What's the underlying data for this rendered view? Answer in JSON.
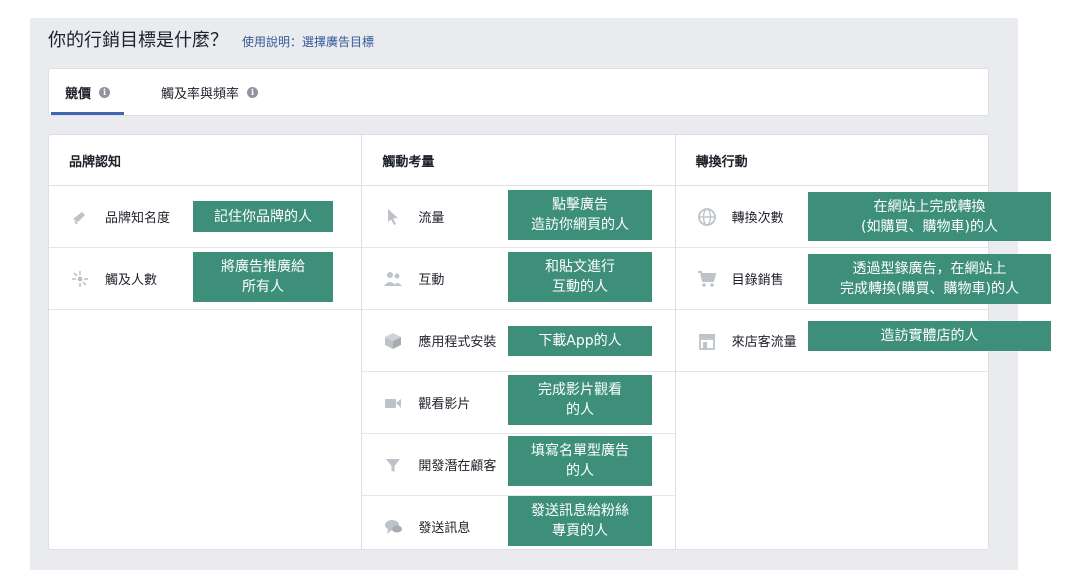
{
  "header": {
    "title": "你的行銷目標是什麼？",
    "help_link": "使用說明：選擇廣告目標"
  },
  "tabs": [
    {
      "label": "競價"
    },
    {
      "label": "觸及率與頻率"
    }
  ],
  "columns": [
    {
      "title": "品牌認知",
      "items": [
        {
          "label": "品牌知名度",
          "icon": "megaphone-icon",
          "note": "記住你品牌的人"
        },
        {
          "label": "觸及人數",
          "icon": "reach-icon",
          "note": "將廣告推廣給\n所有人"
        }
      ]
    },
    {
      "title": "觸動考量",
      "items": [
        {
          "label": "流量",
          "icon": "cursor-icon",
          "note": "點擊廣告\n造訪你網頁的人"
        },
        {
          "label": "互動",
          "icon": "people-icon",
          "note": "和貼文進行\n互動的人"
        },
        {
          "label": "應用程式安裝",
          "icon": "box-icon",
          "note": "下載App的人"
        },
        {
          "label": "觀看影片",
          "icon": "video-icon",
          "note": "完成影片觀看\n的人"
        },
        {
          "label": "開發潛在顧客",
          "icon": "funnel-icon",
          "note": "填寫名單型廣告\n的人"
        },
        {
          "label": "發送訊息",
          "icon": "chat-icon",
          "note": "發送訊息給粉絲\n專頁的人"
        }
      ]
    },
    {
      "title": "轉換行動",
      "items": [
        {
          "label": "轉換次數",
          "icon": "globe-icon",
          "note": "在網站上完成轉換\n(如購買、購物車)的人"
        },
        {
          "label": "目錄銷售",
          "icon": "cart-icon",
          "note": "透過型錄廣告，在網站上\n完成轉換(購買、購物車)的人"
        },
        {
          "label": "來店客流量",
          "icon": "store-icon",
          "note": "造訪實體店的人"
        }
      ]
    }
  ],
  "colors": {
    "note_bg": "#3d8f79",
    "tab_underline": "#4267b2",
    "link": "#365899"
  }
}
